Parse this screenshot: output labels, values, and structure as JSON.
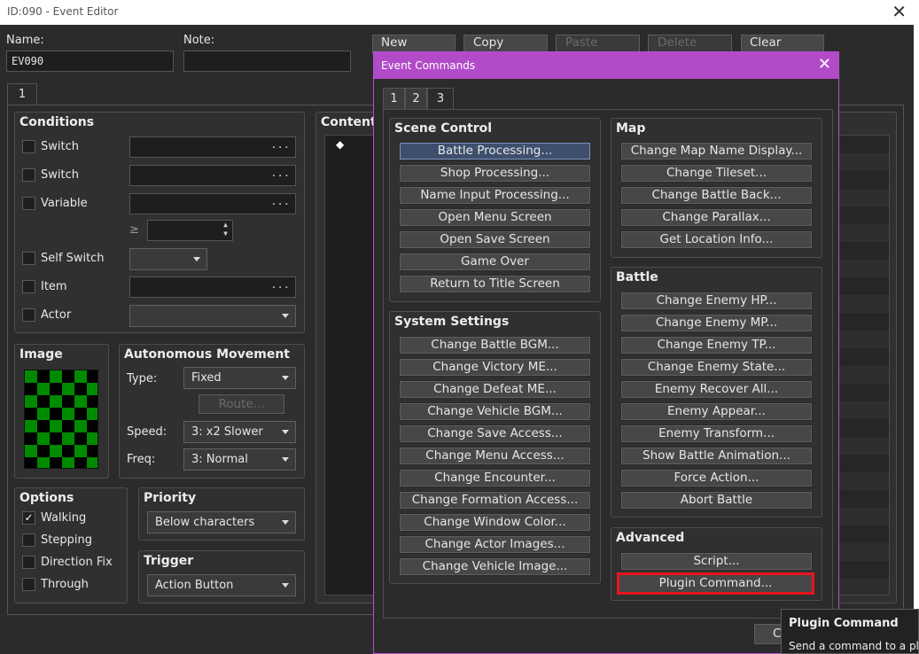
{
  "window": {
    "title": "ID:090 - Event Editor",
    "close": "✕"
  },
  "name": {
    "label": "Name:",
    "value": "EV090"
  },
  "note": {
    "label": "Note:",
    "value": ""
  },
  "toolbar": {
    "new": "New",
    "copy": "Copy",
    "paste": "Paste",
    "delete": "Delete",
    "clear": "Clear"
  },
  "page_tab": "1",
  "conditions": {
    "title": "Conditions",
    "switch1": "Switch",
    "switch2": "Switch",
    "variable": "Variable",
    "ge": "≥",
    "self_switch": "Self Switch",
    "item": "Item",
    "actor": "Actor",
    "ellipsis": "..."
  },
  "image": {
    "title": "Image"
  },
  "movement": {
    "title": "Autonomous Movement",
    "type_label": "Type:",
    "type_value": "Fixed",
    "route": "Route...",
    "speed_label": "Speed:",
    "speed_value": "3: x2 Slower",
    "freq_label": "Freq:",
    "freq_value": "3: Normal"
  },
  "options": {
    "title": "Options",
    "walking": "Walking",
    "walking_checked": "✓",
    "stepping": "Stepping",
    "direction_fix": "Direction Fix",
    "through": "Through"
  },
  "priority": {
    "title": "Priority",
    "value": "Below characters"
  },
  "trigger": {
    "title": "Trigger",
    "value": "Action Button"
  },
  "contents": {
    "title": "Contents",
    "bullet": "◆"
  },
  "dialog": {
    "title": "Event Commands",
    "close": "✕",
    "tabs": [
      "1",
      "2",
      "3"
    ],
    "scene_control": {
      "title": "Scene Control",
      "items": [
        "Battle Processing...",
        "Shop Processing...",
        "Name Input Processing...",
        "Open Menu Screen",
        "Open Save Screen",
        "Game Over",
        "Return to Title Screen"
      ]
    },
    "system_settings": {
      "title": "System Settings",
      "items": [
        "Change Battle BGM...",
        "Change Victory ME...",
        "Change Defeat ME...",
        "Change Vehicle BGM...",
        "Change Save Access...",
        "Change Menu Access...",
        "Change Encounter...",
        "Change Formation Access...",
        "Change Window Color...",
        "Change Actor Images...",
        "Change Vehicle Image..."
      ]
    },
    "map": {
      "title": "Map",
      "items": [
        "Change Map Name Display...",
        "Change Tileset...",
        "Change Battle Back...",
        "Change Parallax...",
        "Get Location Info..."
      ]
    },
    "battle": {
      "title": "Battle",
      "items": [
        "Change Enemy HP...",
        "Change Enemy MP...",
        "Change Enemy TP...",
        "Change Enemy State...",
        "Enemy Recover All...",
        "Enemy Appear...",
        "Enemy Transform...",
        "Show Battle Animation...",
        "Force Action...",
        "Abort Battle"
      ]
    },
    "advanced": {
      "title": "Advanced",
      "items": [
        "Script...",
        "Plugin Command..."
      ]
    },
    "cancel_partial": "C"
  },
  "tooltip": {
    "title": "Plugin Command",
    "desc": "Send a command to a plu"
  },
  "colors": {
    "dialog_accent": "#b14bc8",
    "highlight": "#e8141c",
    "checker_green": "#008a00"
  }
}
